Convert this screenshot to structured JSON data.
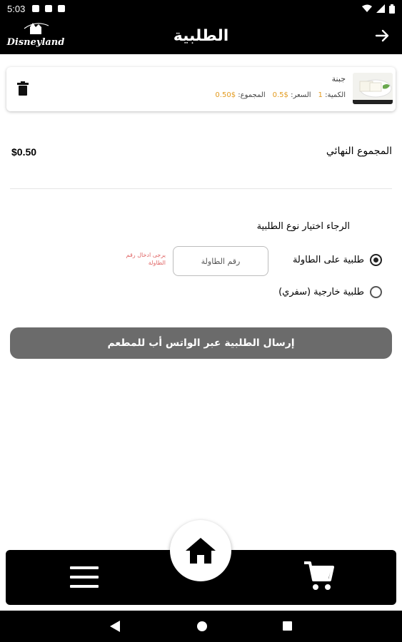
{
  "status_bar": {
    "time": "5:03"
  },
  "header": {
    "title": "الطلبية",
    "logo_text": "Disneyland"
  },
  "cart_item": {
    "name": "جبنة",
    "qty_label": "الكمية:",
    "qty_value": "1",
    "price_label": "السعر:",
    "price_value": "$0.5",
    "total_label": "المجموع:",
    "total_value": "$0.50"
  },
  "summary": {
    "label": "المجموع النهائي",
    "value": "$0.50"
  },
  "order_type": {
    "prompt": "الرجاء اختيار نوع الطلبية",
    "options": [
      {
        "label": "طلبية على الطاولة",
        "selected": true
      },
      {
        "label": "طلبية خارجية (سفري)",
        "selected": false
      }
    ],
    "table_input_placeholder": "رقم الطاولة",
    "table_error": "يرجى ادخال رقم الطاولة"
  },
  "submit_label": "إرسال الطلبية عبر الواتس أب للمطعم",
  "colors": {
    "accent": "#e39a1d",
    "button": "#6b6b6b",
    "bar": "#000000",
    "error": "#e06666"
  }
}
